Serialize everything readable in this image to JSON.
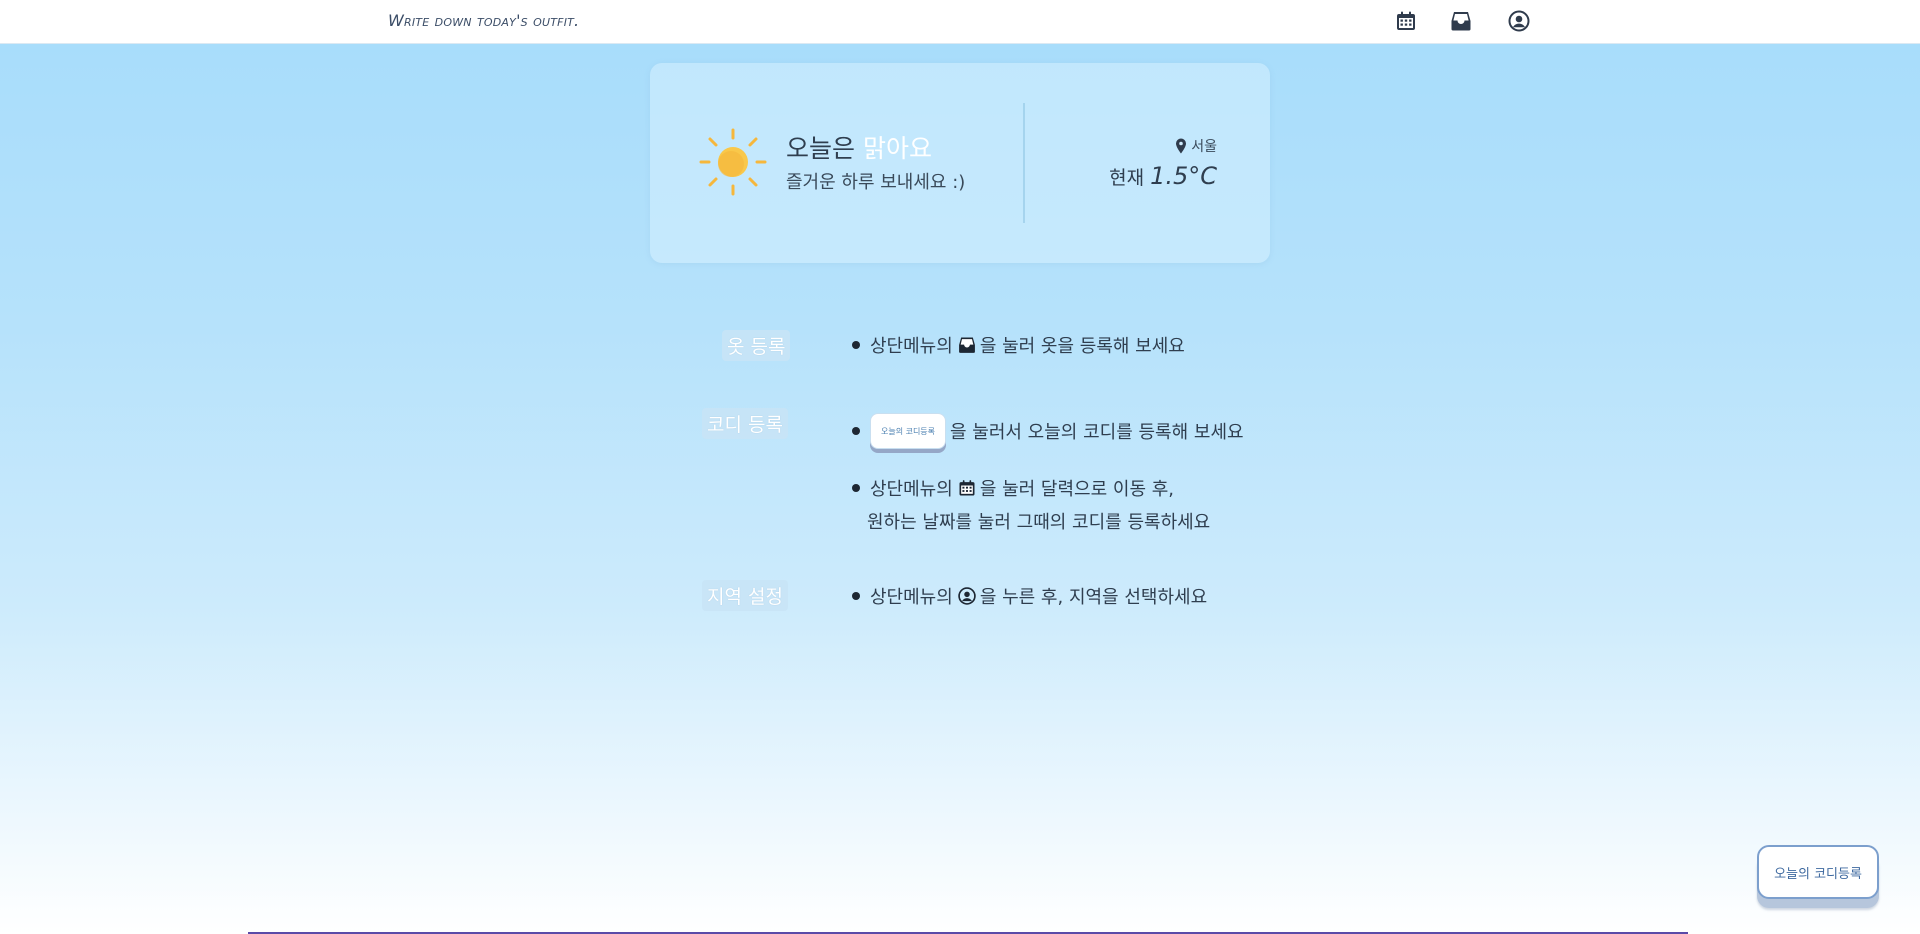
{
  "header": {
    "brand": "Write down today's outfit.",
    "icons": [
      "calendar-icon",
      "closet-icon",
      "user-circle-icon"
    ]
  },
  "weather": {
    "title_prefix": "오늘은 ",
    "condition": "맑아요",
    "subtitle": "즐거운 하루 보내세요 :)",
    "location": "서울",
    "current_label": "현재",
    "temperature": "1.5°C",
    "icon": "sun-icon"
  },
  "guide": {
    "clothes": {
      "label": "옷 등록",
      "line1_before": "상단메뉴의",
      "line1_after": "을 눌러 옷을 등록해 보세요"
    },
    "outfit": {
      "label": "코디 등록",
      "mini_button": "오늘의 코디등록",
      "line1_after": "을 눌러서 오늘의 코디를 등록해 보세요",
      "line2_before": "상단메뉴의",
      "line2_after": "을 눌러 달력으로 이동 후,",
      "line3": "원하는 날짜를 눌러 그때의 코디를 등록하세요"
    },
    "region": {
      "label": "지역 설정",
      "line1_before": "상단메뉴의",
      "line1_after": "을 누른 후, 지역을 선택하세요"
    }
  },
  "fab": {
    "label": "오늘의 코디등록"
  },
  "colors": {
    "accent": "#7c9fcd",
    "sky_top": "#a6dcfb",
    "text": "#2f3e4f",
    "sun": "#f9bd3c"
  }
}
